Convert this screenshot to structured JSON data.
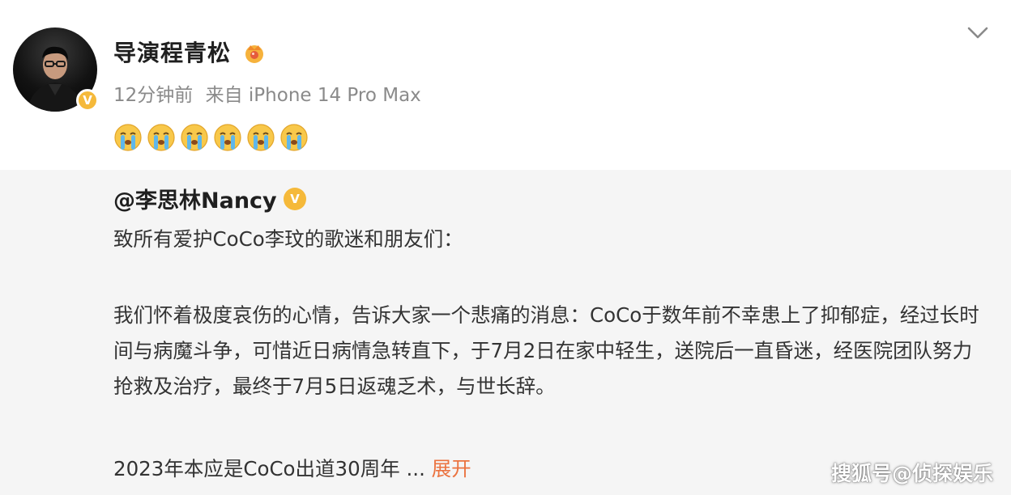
{
  "post": {
    "username": "导演程青松",
    "time": "12分钟前",
    "source": "来自 iPhone 14 Pro Max",
    "emojis": [
      "crying-face",
      "crying-face",
      "crying-face",
      "crying-face",
      "crying-face",
      "crying-face"
    ]
  },
  "repost": {
    "author": "@李思林Nancy",
    "greeting": "致所有爱护CoCo李玟的歌迷和朋友们：",
    "body": "我们怀着极度哀伤的心情，告诉大家一个悲痛的消息：CoCo于数年前不幸患上了抑郁症，经过长时间与病魔斗争，可惜近日病情急转直下，于7月2日在家中轻生，送院后一直昏迷，经医院团队努力抢救及治疗，最终于7月5日返魂乏术，与世长辞。",
    "last_line": "2023年本应是CoCo出道30周年 ...",
    "expand_label": "展开"
  },
  "watermark": "搜狐号@侦探娱乐",
  "colors": {
    "verified": "#f5b93a",
    "expand": "#eb7340",
    "repost_bg": "#f5f5f5",
    "meta": "#8a8a8a"
  }
}
